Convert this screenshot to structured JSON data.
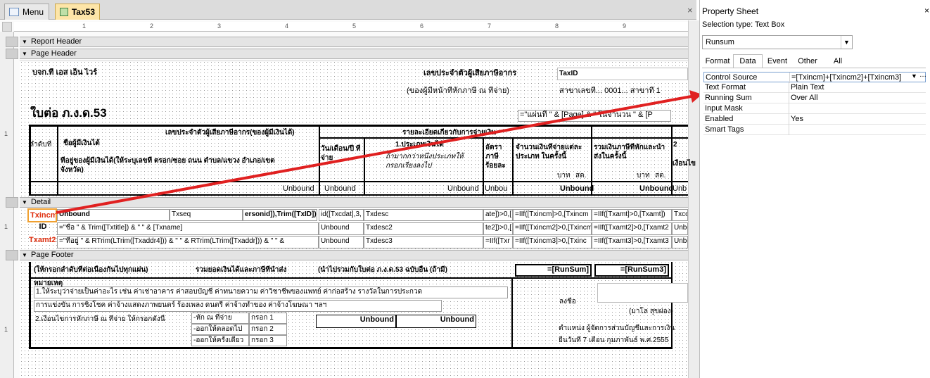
{
  "tabs": [
    {
      "label": "Menu"
    },
    {
      "label": "Tax53"
    }
  ],
  "close_glyph": "×",
  "ruler": {
    "marks": [
      "1",
      "2",
      "3",
      "4",
      "5",
      "6",
      "7",
      "8",
      "9"
    ],
    "vertical": [
      "1",
      "1",
      "1"
    ]
  },
  "bands": {
    "report_header": "Report Header",
    "page_header": "Page Header",
    "detail": "Detail",
    "page_footer": "Page Footer"
  },
  "page_header": {
    "company": "บจก.ที เอส เอ็น ไวร์",
    "taxid_label": "เลขประจำตัวผู้เสียภาษีอากร",
    "taxid_value": "TaxID",
    "payer_note": "(ของผู้มีหน้าที่หักภาษี ณ ที่จ่าย)",
    "branch": "สาขาเลขที่... 0001... สาขาที่ 1",
    "form_title": "ใบต่อ ภ.ง.ด.53",
    "page_expr": "=\"แผ่นที่ \" & [Page] & \" ในจำนวน \" & [P",
    "col_seq": "ลำดับที่",
    "col_taxid_payee": "เลขประจำตัวผู้เสียภาษีอากร(ของผู้มีเงินได้)",
    "col_details": "รายละเอียดเกี่ยวกับการจ่ายเงิน",
    "col_name": "ชื่อผู้มีเงินได้",
    "col_address": "ที่อยู่ของผู้มีเงินได้(ให้ระบุเลขที่ ตรอก/ซอย ถนน ตำบล/แขวง อำเภอ/เขต จังหวัด)",
    "col_date": "วัน/เดือน/ปี ที่จ่าย",
    "col_type": "1.ประเภทเงินได้",
    "col_type_note": "ถ้ามากกว่าหนึ่งประเภทให้กรอกเรียงลงไป",
    "col_rate": "อัตราภาษี ร้อยละ",
    "col_amount": "จำนวนเงินที่จ่ายแต่ละประเภท ในครั้งนี้",
    "col_total": "รวมเงินภาษีที่หักและนำส่งในครั้งนี้",
    "col_cond": "เงื่อนไข",
    "col_num": "2",
    "baht": "บาท",
    "satang": "สต.",
    "unbound_row": [
      "Unbound",
      "Unbound",
      "Unbound",
      "Unbou",
      "Unbound",
      "Unbound",
      "Unb"
    ]
  },
  "detail": {
    "selected_label": "Txincm1",
    "id_label": "ID",
    "txamt2_label": "Txamt2",
    "r1": [
      "Unbound",
      "Txseq",
      "ersonid]),Trim([TxID]))",
      "id([Txcdat],3,",
      "Txdesc",
      "ate])>0,[",
      "=IIf([Txincm]>0,[Txincm",
      "=IIf([Txamt]>0,[Txamt])",
      "Txco"
    ],
    "r2": [
      "=\"ชื่อ \" & Trim([Txtitle]) & \" \" & [Txname]",
      "Unbound",
      "Txdesc2",
      "te2])>0,[",
      "=IIf([Txincm2]>0,[Txincm",
      "=IIf([Txamt2]>0,[Txamt2",
      "Unbo"
    ],
    "r3": [
      "=\"ที่อยู่ \" & RTrim(LTrim([Txaddr4])) & \" \" & RTrim(LTrim([Txaddr])) & \" \" &",
      "Unbound",
      "Txdesc3",
      "=IIf([Txr",
      "=IIf([Txincm3]>0,[Txinc",
      "=IIf([Txamt3]>0,[Txamt3",
      "Unbo"
    ]
  },
  "footer": {
    "note1": "(ให้กรอกลำดับที่ต่อเนื่องกันไปทุกแผ่น)",
    "note2": "รวมยอดเงินได้และภาษีที่นำส่ง",
    "note3": "(นำไปรวมกับใบต่อ ภ.ง.ด.53 ฉบับอื่น (ถ้ามี)",
    "runsum": "=[RunSum]",
    "runsum3": "=[RunSum3]",
    "remark": "หมายเหตุ",
    "rem1": "1.ให้ระบุว่าจ่ายเป็นค่าอะไร เช่น ค่าเช่าอาคาร ค่าสอบบัญชี ค่าทนายความ ค่าวิชาชีพของแพทย์ ค่าก่อสร้าง รางวัลในการประกวด",
    "rem1b": "การแข่งขัน การชิงโชค ค่าจ้างแสดงภาพยนตร์ ร้องเพลง ดนตรี ค่าจ้างทำของ ค่าจ้างโฆษณา ฯลฯ",
    "rem2": "2.เงื่อนไขการหักภาษี ณ ที่จ่าย ให้กรอกดังนี้",
    "c1": "-หัก ณ ที่จ่าย",
    "c2": "-ออกให้ตลอดไป",
    "c3": "-ออกให้ครั้งเดียว",
    "k1": "กรอก 1",
    "k2": "กรอก 2",
    "k3": "กรอก 3",
    "unbound1": "Unbound",
    "unbound2": "Unbound",
    "sign": "ลงชื่อ",
    "signer": "(มาโล สุขผ่อง)",
    "position": "ตำแหน่ง   ผู้จัดการส่วนบัญชีและการเงิน",
    "date": "ยื่นวันที่ 7 เดือน กุมภาพันธ์ พ.ศ.2555"
  },
  "property_sheet": {
    "title": "Property Sheet",
    "close": "×",
    "selection_type": "Selection type:  Text Box",
    "selected_control": "Runsum",
    "tabs": [
      "Format",
      "Data",
      "Event",
      "Other",
      "All"
    ],
    "active_tab": "Data",
    "rows": [
      {
        "label": "Control Source",
        "value": "=[Txincm]+[Txincm2]+[Txincm3]"
      },
      {
        "label": "Text Format",
        "value": "Plain Text"
      },
      {
        "label": "Running Sum",
        "value": "Over All"
      },
      {
        "label": "Input Mask",
        "value": ""
      },
      {
        "label": "Enabled",
        "value": "Yes"
      },
      {
        "label": "Smart Tags",
        "value": ""
      }
    ]
  },
  "colors": {
    "arrow": "#e02020",
    "selected_border": "#f0a030",
    "selected_text": "#e03010",
    "tab_active": "#fde5a8"
  }
}
